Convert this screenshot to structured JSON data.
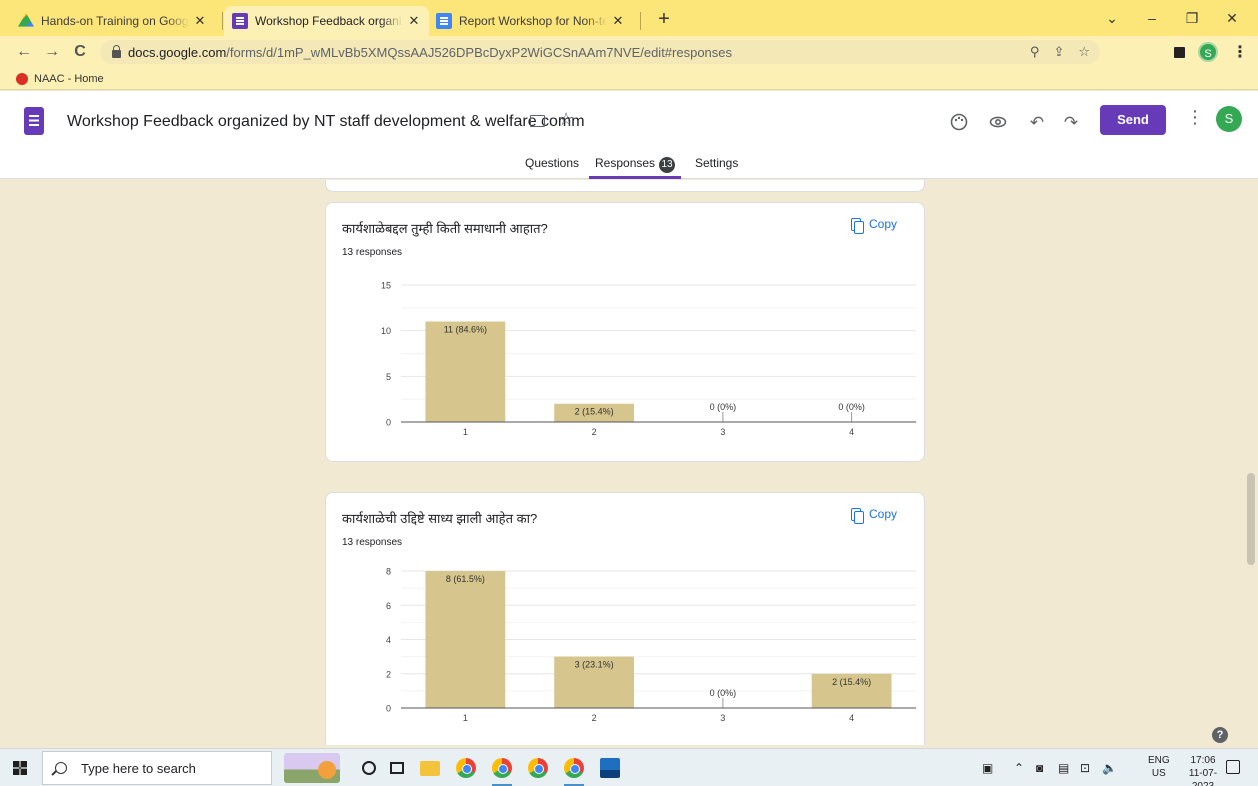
{
  "browser": {
    "tabs": [
      {
        "title": "Hands-on Training on Google Ap",
        "icon": "google-drive-icon"
      },
      {
        "title": "Workshop Feedback organized b",
        "icon": "google-forms-icon",
        "active": true
      },
      {
        "title": "Report Workshop for Non-teachi",
        "icon": "google-docs-icon"
      }
    ],
    "new_tab_label": "+",
    "url_host": "docs.google.com",
    "url_path": "/forms/d/1mP_wMLvBb5XMQssAAJ526DPBcDyxP2WiGCSnAAm7NVE/edit#responses",
    "profile_initial": "S",
    "bookmarks": [
      {
        "label": "NAAC - Home"
      }
    ]
  },
  "form": {
    "title": "Workshop Feedback organized by NT staff development & welfare comm",
    "send_label": "Send",
    "avatar_initial": "S",
    "tabs": {
      "questions": "Questions",
      "responses": "Responses",
      "responses_count": "13",
      "settings": "Settings"
    },
    "copy_label": "Copy",
    "accent_color": "#673ab7"
  },
  "chart_data": [
    {
      "type": "bar",
      "title": "कार्यशाळेबद्दल तुम्ही किती समाधानी आहात?",
      "subtitle": "13 responses",
      "categories": [
        "1",
        "2",
        "3",
        "4"
      ],
      "values": [
        11,
        2,
        0,
        0
      ],
      "data_labels": [
        "11 (84.6%)",
        "2 (15.4%)",
        "0 (0%)",
        "0 (0%)"
      ],
      "yticks": [
        0,
        5,
        10,
        15
      ],
      "ylim": [
        0,
        15
      ],
      "bar_color": "#d6c58c",
      "grid": true
    },
    {
      "type": "bar",
      "title": "कार्यशाळेची उद्दिष्टे साध्य झाली आहेत का?",
      "subtitle": "13 responses",
      "categories": [
        "1",
        "2",
        "3",
        "4"
      ],
      "values": [
        8,
        3,
        0,
        2
      ],
      "data_labels": [
        "8 (61.5%)",
        "3 (23.1%)",
        "0 (0%)",
        "2 (15.4%)"
      ],
      "yticks": [
        0,
        2,
        4,
        6,
        8
      ],
      "ylim": [
        0,
        8
      ],
      "bar_color": "#d6c58c",
      "grid": true
    }
  ],
  "taskbar": {
    "search_placeholder": "Type here to search",
    "lang_top": "ENG",
    "lang_bottom": "US",
    "time": "17:06",
    "date": "11-07-2023"
  }
}
